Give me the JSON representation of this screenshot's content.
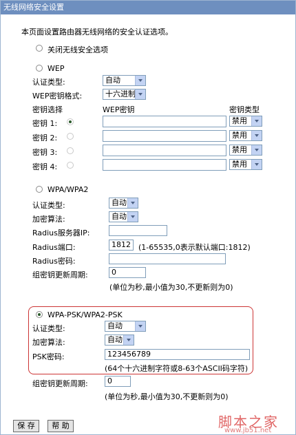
{
  "title": "无线网络安全设置",
  "intro": "本页面设置路由器无线网络的安全认证选项。",
  "options": {
    "disable_label": "关闭无线安全选项",
    "wep_label": "WEP",
    "wpa_label": "WPA/WPA2",
    "psk_label": "WPA-PSK/WPA2-PSK"
  },
  "wep": {
    "auth_label": "认证类型:",
    "auth_value": "自动",
    "format_label": "WEP密钥格式:",
    "format_value": "十六进制",
    "col_select": "密钥选择",
    "col_key": "WEP密钥",
    "col_type": "密钥类型",
    "keys": [
      {
        "label": "密钥 1:",
        "type": "禁用"
      },
      {
        "label": "密钥 2:",
        "type": "禁用"
      },
      {
        "label": "密钥 3:",
        "type": "禁用"
      },
      {
        "label": "密钥 4:",
        "type": "禁用"
      }
    ]
  },
  "wpa": {
    "auth_label": "认证类型:",
    "auth_value": "自动",
    "enc_label": "加密算法:",
    "enc_value": "自动",
    "radius_ip_label": "Radius服务器IP:",
    "radius_ip_value": "",
    "radius_port_label": "Radius端口:",
    "radius_port_value": "1812",
    "radius_port_hint": "(1-65535,0表示默认端口:1812)",
    "radius_pwd_label": "Radius密码:",
    "radius_pwd_value": "",
    "renew_label": "组密钥更新周期:",
    "renew_value": "0",
    "renew_hint": "(单位为秒,最小值为30,不更新则为0)"
  },
  "psk": {
    "auth_label": "认证类型:",
    "auth_value": "自动",
    "enc_label": "加密算法:",
    "enc_value": "自动",
    "pwd_label": "PSK密码:",
    "pwd_value": "123456789",
    "pwd_hint": "(64个十六进制字符或8-63个ASCII码字符)",
    "renew_label": "组密钥更新周期:",
    "renew_value": "0",
    "renew_hint": "(单位为秒,最小值为30,不更新则为0)"
  },
  "buttons": {
    "save": "保 存",
    "help": "帮 助"
  },
  "watermark": {
    "name": "脚本之家",
    "url": "www.jb51.net"
  }
}
